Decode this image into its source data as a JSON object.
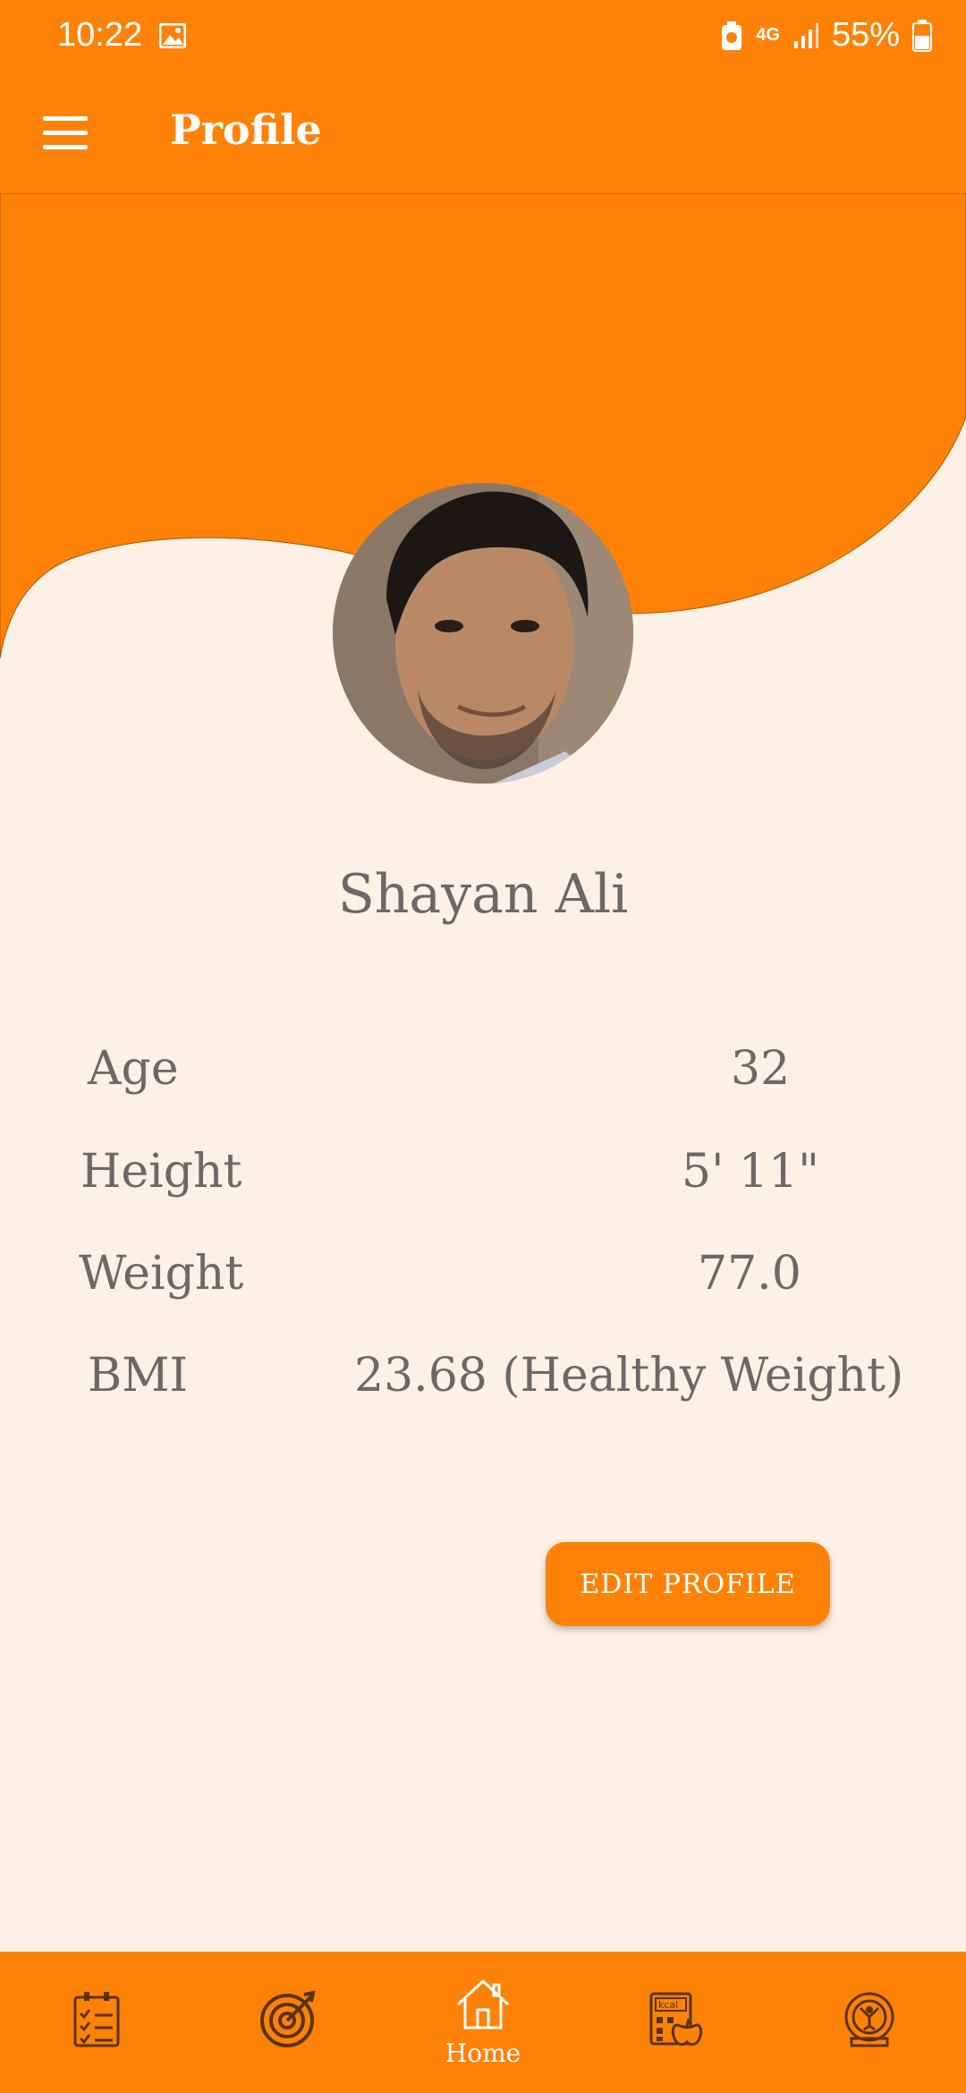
{
  "status_bar": {
    "time": "10:22",
    "network": "4G",
    "battery": "55%"
  },
  "app_bar": {
    "title": "Profile"
  },
  "profile": {
    "name": "Shayan Ali"
  },
  "stats": [
    {
      "label": "Age",
      "value": "32"
    },
    {
      "label": "Height",
      "value": "5' 11\""
    },
    {
      "label": "Weight",
      "value": "77.0"
    },
    {
      "label": "BMI",
      "value": "23.68 (Healthy Weight)"
    }
  ],
  "edit_button": {
    "label": "EDIT PROFILE"
  },
  "bottom_nav": {
    "items": [
      {
        "icon": "checklist-icon",
        "label": ""
      },
      {
        "icon": "target-icon",
        "label": ""
      },
      {
        "icon": "home-icon",
        "label": "Home"
      },
      {
        "icon": "calorie-calculator-icon",
        "label": ""
      },
      {
        "icon": "fitness-badge-icon",
        "label": ""
      }
    ]
  },
  "colors": {
    "accent": "#fe8208",
    "background": "#fdf0e5",
    "text": "#6b6866"
  }
}
